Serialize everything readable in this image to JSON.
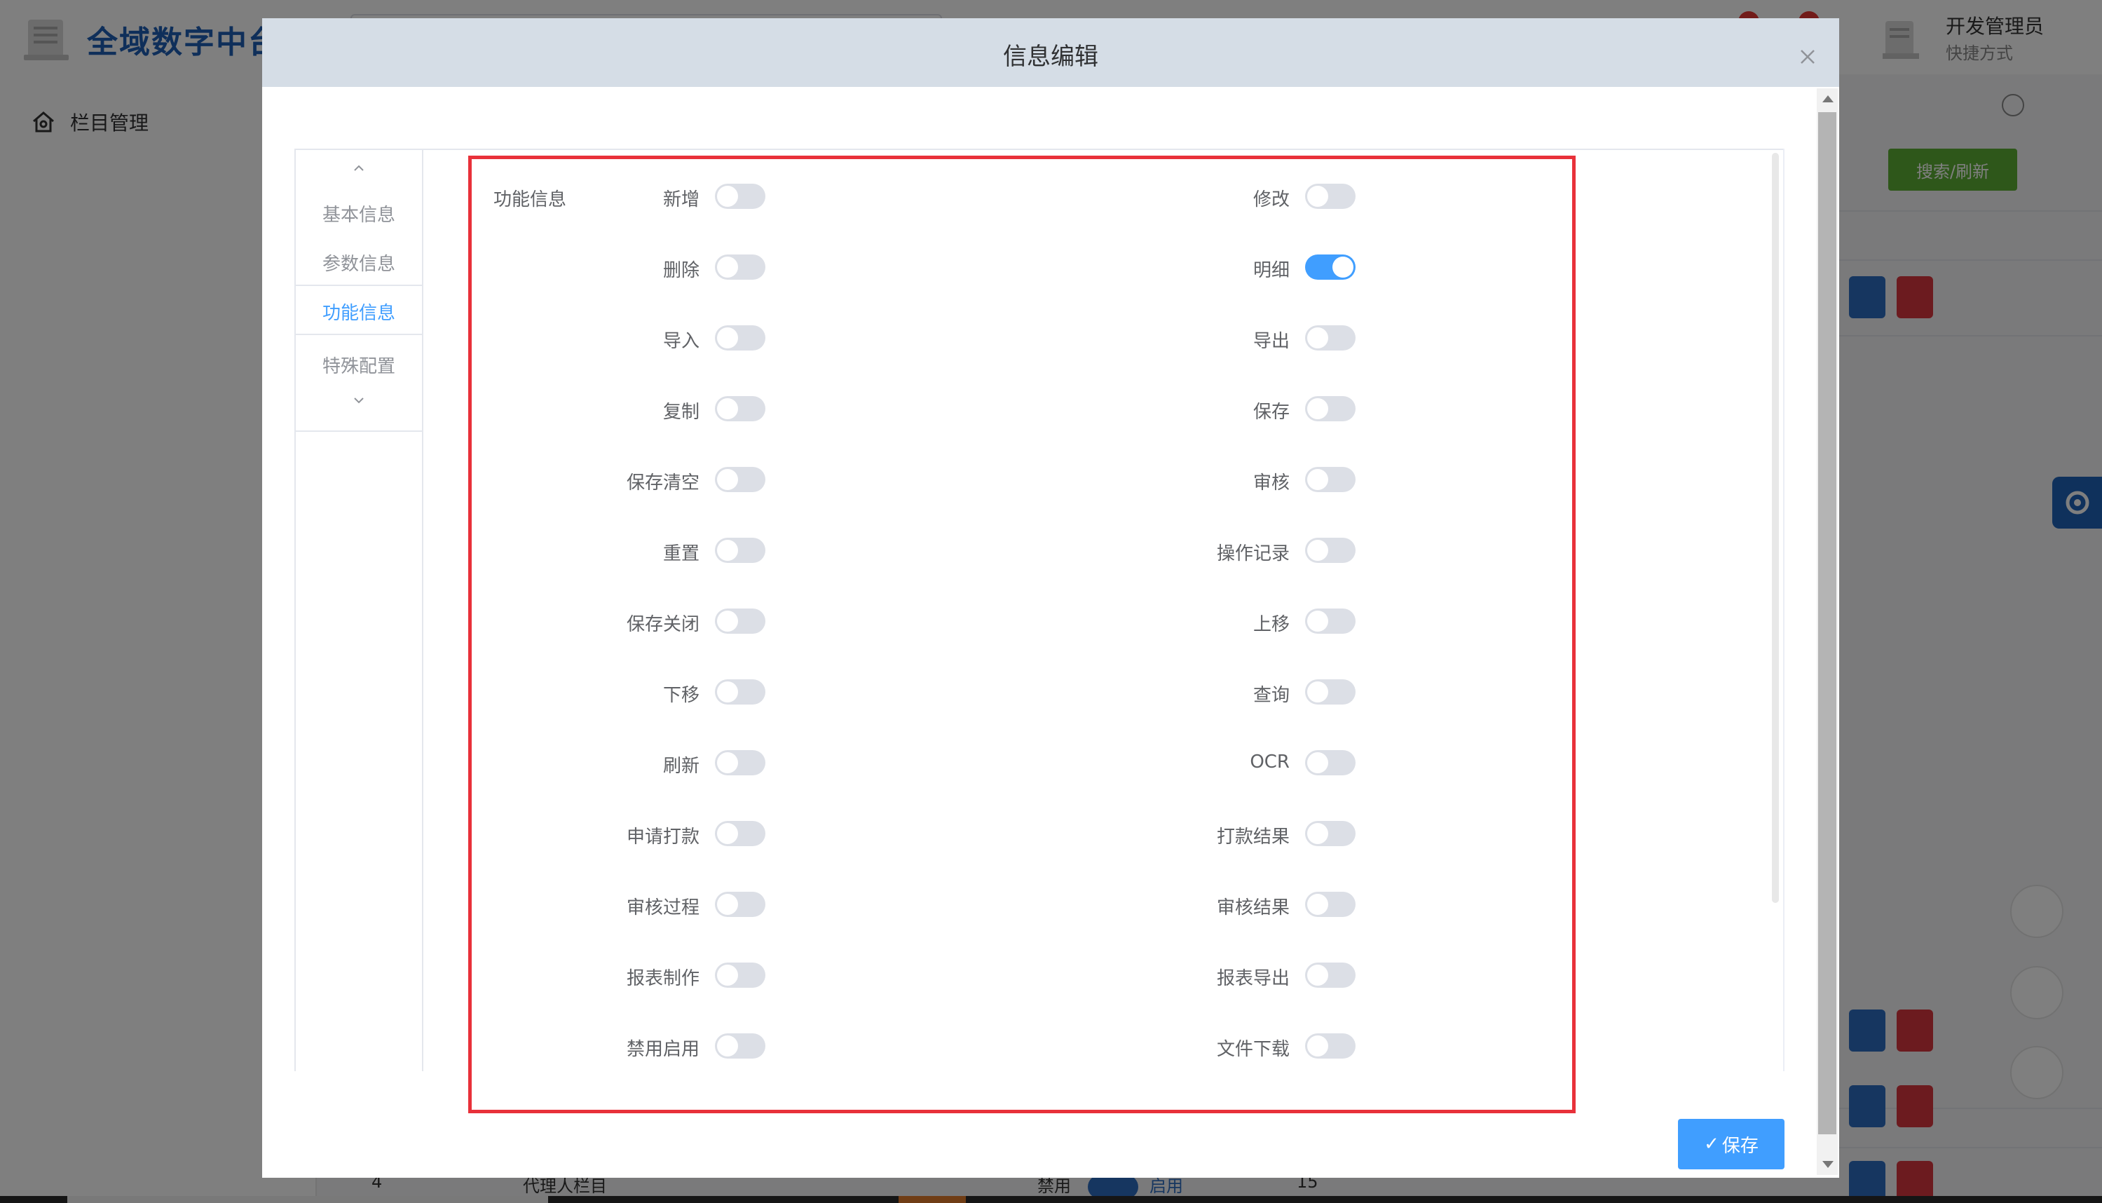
{
  "app": {
    "title": "全域数字中台",
    "user_name": "开发管理员",
    "user_sub": "快捷方式",
    "sidebar_item": "栏目管理",
    "search_refresh": "搜索/刷新",
    "bottom_row": {
      "num": "4",
      "name": "代理人栏目",
      "status_label": "禁用",
      "status_value": "启用",
      "sort": "15"
    }
  },
  "dialog": {
    "title": "信息编辑",
    "tabs": [
      {
        "label": "基本信息",
        "active": false
      },
      {
        "label": "参数信息",
        "active": false
      },
      {
        "label": "功能信息",
        "active": true
      },
      {
        "label": "特殊配置",
        "active": false
      }
    ],
    "section_label": "功能信息",
    "switches": [
      {
        "label": "新增",
        "on": false
      },
      {
        "label": "修改",
        "on": false
      },
      {
        "label": "删除",
        "on": false
      },
      {
        "label": "明细",
        "on": true
      },
      {
        "label": "导入",
        "on": false
      },
      {
        "label": "导出",
        "on": false
      },
      {
        "label": "复制",
        "on": false
      },
      {
        "label": "保存",
        "on": false
      },
      {
        "label": "保存清空",
        "on": false
      },
      {
        "label": "审核",
        "on": false
      },
      {
        "label": "重置",
        "on": false
      },
      {
        "label": "操作记录",
        "on": false
      },
      {
        "label": "保存关闭",
        "on": false
      },
      {
        "label": "上移",
        "on": false
      },
      {
        "label": "下移",
        "on": false
      },
      {
        "label": "查询",
        "on": false
      },
      {
        "label": "刷新",
        "on": false
      },
      {
        "label": "OCR",
        "on": false
      },
      {
        "label": "申请打款",
        "on": false
      },
      {
        "label": "打款结果",
        "on": false
      },
      {
        "label": "审核过程",
        "on": false
      },
      {
        "label": "审核结果",
        "on": false
      },
      {
        "label": "报表制作",
        "on": false
      },
      {
        "label": "报表导出",
        "on": false
      },
      {
        "label": "禁用启用",
        "on": false
      },
      {
        "label": "文件下载",
        "on": false
      }
    ],
    "save_label": "保存",
    "colors": {
      "accent": "#409eff",
      "highlight_border": "#e8313a",
      "switch_off": "#dcdfe6"
    }
  }
}
